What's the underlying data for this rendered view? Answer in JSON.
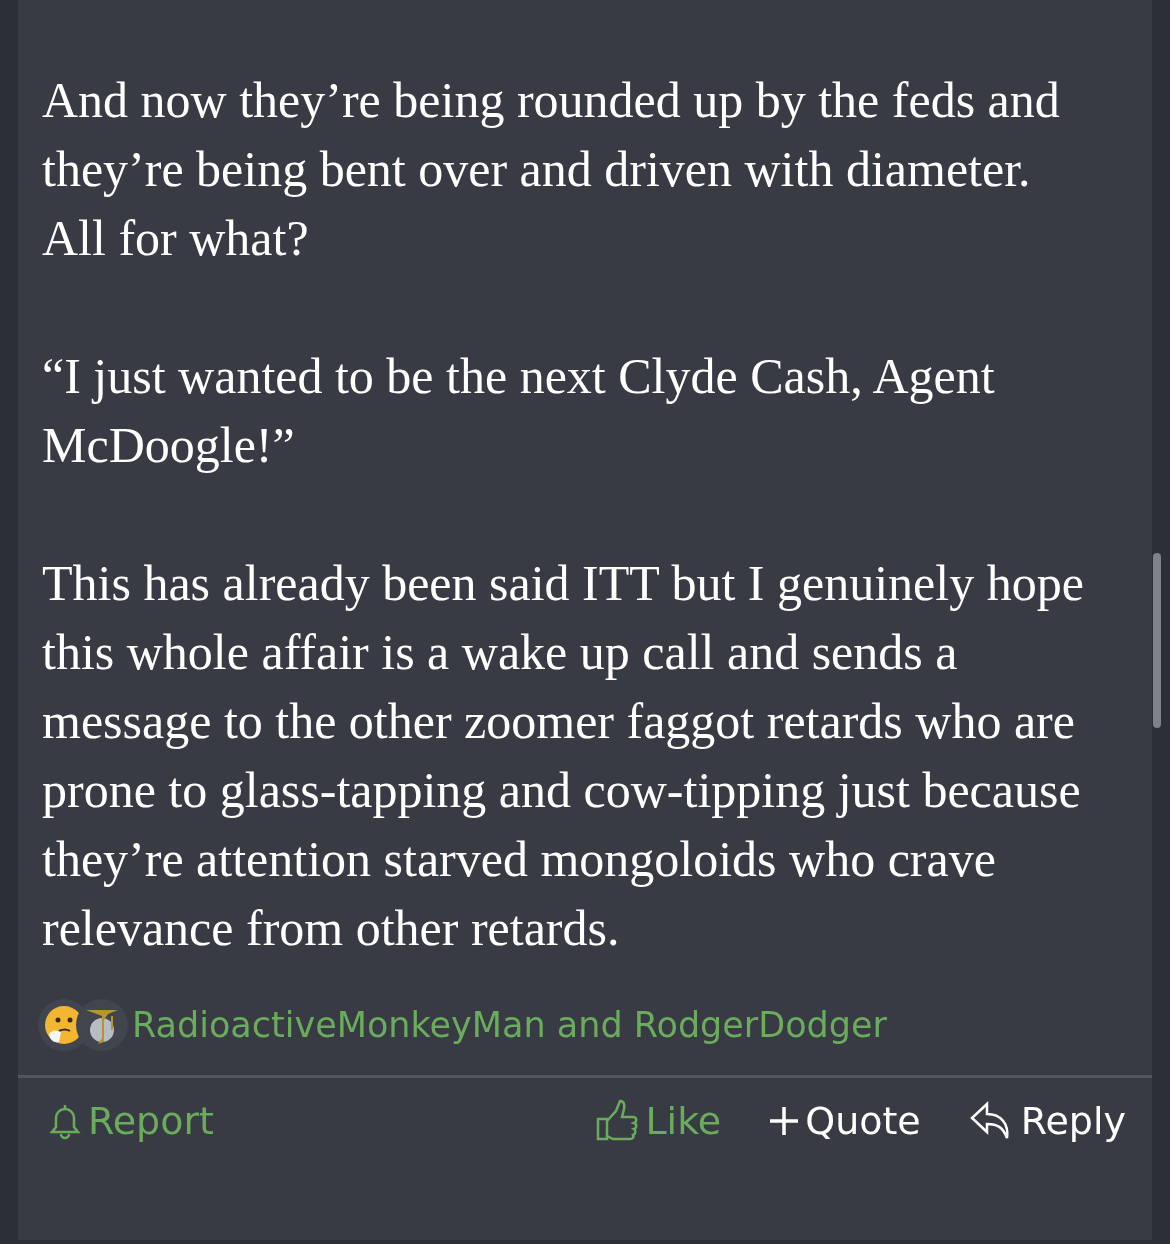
{
  "post": {
    "paragraphs": [
      "And now they’re being rounded up by the feds and they’re being bent over and driven with diameter. All for what?",
      "“I just wanted to be the next Clyde Cash, Agent McDoogle!”",
      "This has already been said ITT but I genuinely hope this whole affair is a wake up call and sends a message to the other zoomer faggot retards who are prone to glass-tapping and cow-tipping just because they’re attention starved mongoloids who crave relevance from other retards."
    ],
    "reactions": {
      "icons": [
        {
          "kind": "thinking"
        },
        {
          "kind": "emblem"
        }
      ],
      "users": "RadioactiveMonkeyMan and RodgerDodger"
    },
    "actions": [
      {
        "kind": "report",
        "label": "Report",
        "color": "#6aac5c"
      },
      {
        "kind": "like",
        "label": "Like",
        "color": "#6aac5c"
      },
      {
        "kind": "quote",
        "label": "Quote",
        "color": "#ffffff"
      },
      {
        "kind": "reply",
        "label": "Reply",
        "color": "#ffffff"
      }
    ]
  }
}
